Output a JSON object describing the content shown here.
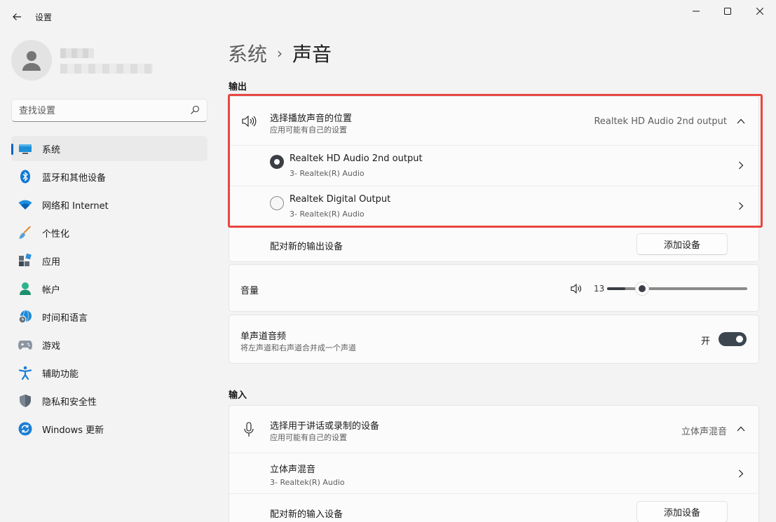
{
  "window": {
    "title": "设置"
  },
  "profile": {},
  "search": {
    "placeholder": "查找设置"
  },
  "sidebar": {
    "items": [
      {
        "label": "系统",
        "icon": "system-icon"
      },
      {
        "label": "蓝牙和其他设备",
        "icon": "bluetooth-icon"
      },
      {
        "label": "网络和 Internet",
        "icon": "wifi-icon"
      },
      {
        "label": "个性化",
        "icon": "brush-icon"
      },
      {
        "label": "应用",
        "icon": "apps-icon"
      },
      {
        "label": "帐户",
        "icon": "account-icon"
      },
      {
        "label": "时间和语言",
        "icon": "globe-clock-icon"
      },
      {
        "label": "游戏",
        "icon": "gamepad-icon"
      },
      {
        "label": "辅助功能",
        "icon": "accessibility-icon"
      },
      {
        "label": "隐私和安全性",
        "icon": "shield-icon"
      },
      {
        "label": "Windows 更新",
        "icon": "update-icon"
      }
    ]
  },
  "breadcrumb": {
    "parent": "系统",
    "separator": "›",
    "current": "声音"
  },
  "output": {
    "section_label": "输出",
    "choose": {
      "title": "选择播放声音的位置",
      "subtitle": "应用可能有自己的设置",
      "value": "Realtek HD Audio 2nd output"
    },
    "devices": [
      {
        "name": "Realtek HD Audio 2nd output",
        "detail": "3- Realtek(R) Audio",
        "selected": true
      },
      {
        "name": "Realtek Digital Output",
        "detail": "3- Realtek(R) Audio",
        "selected": false
      }
    ],
    "pair": {
      "label": "配对新的输出设备",
      "button": "添加设备"
    },
    "volume": {
      "label": "音量",
      "value": "13",
      "level_percent": 13
    },
    "mono": {
      "title": "单声道音频",
      "subtitle": "将左声道和右声道合并成一个声道",
      "state": "开"
    }
  },
  "input": {
    "section_label": "输入",
    "choose": {
      "title": "选择用于讲话或录制的设备",
      "subtitle": "应用可能有自己的设置",
      "value": "立体声混音"
    },
    "devices": [
      {
        "name": "立体声混音",
        "detail": "3- Realtek(R) Audio"
      }
    ],
    "pair": {
      "label": "配对新的输入设备",
      "button": "添加设备"
    }
  },
  "colors": {
    "accent": "#0067c0",
    "highlight": "#e8463f",
    "toggle_on": "#3b4650"
  }
}
